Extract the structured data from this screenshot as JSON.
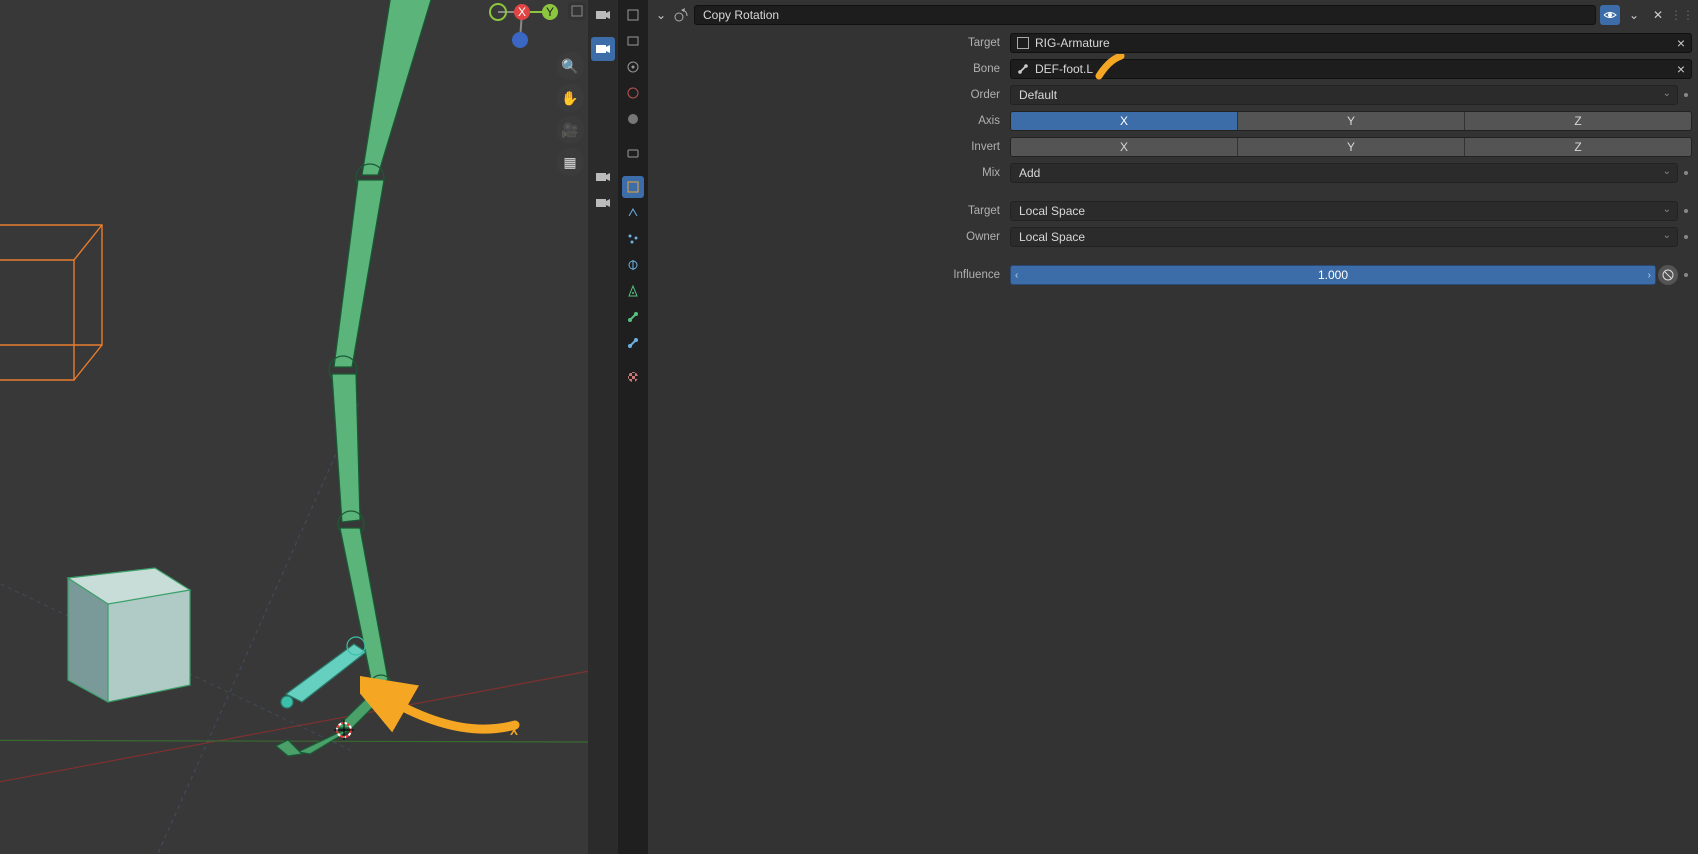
{
  "constraint": {
    "name": "Copy Rotation",
    "target_label": "Target",
    "target_value": "RIG-Armature",
    "bone_label": "Bone",
    "bone_value": "DEF-foot.L",
    "order_label": "Order",
    "order_value": "Default",
    "axis_label": "Axis",
    "axis_options": [
      "X",
      "Y",
      "Z"
    ],
    "axis_active": [
      true,
      false,
      false
    ],
    "invert_label": "Invert",
    "invert_options": [
      "X",
      "Y",
      "Z"
    ],
    "invert_active": [
      false,
      false,
      false
    ],
    "mix_label": "Mix",
    "mix_value": "Add",
    "target_space_label": "Target",
    "target_space_value": "Local Space",
    "owner_label": "Owner",
    "owner_value": "Local Space",
    "influence_label": "Influence",
    "influence_value": "1.000"
  },
  "viewport": {
    "axes": {
      "x": "X",
      "y": "Y"
    },
    "annotation_text": "X"
  },
  "icons": {
    "zoom": "🔍",
    "hand": "✋",
    "camera": "🎥",
    "grid": "▦",
    "cam2": "📷"
  }
}
